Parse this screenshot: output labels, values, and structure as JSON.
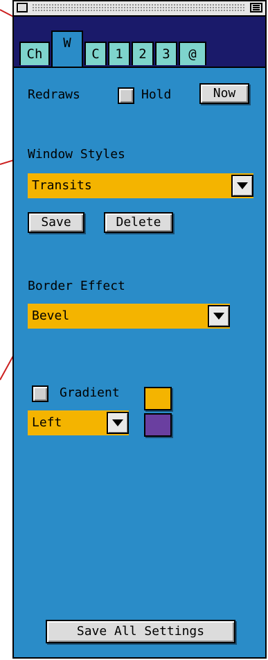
{
  "tabs": [
    {
      "label": "Ch",
      "active": false
    },
    {
      "label": "W",
      "active": true
    },
    {
      "label": "C",
      "active": false
    },
    {
      "label": "1",
      "active": false
    },
    {
      "label": "2",
      "active": false
    },
    {
      "label": "3",
      "active": false
    },
    {
      "label": "@",
      "active": false
    }
  ],
  "redraws": {
    "label": "Redraws",
    "hold_label": "Hold",
    "hold_checked": false,
    "now_button": "Now"
  },
  "window_styles": {
    "label": "Window Styles",
    "selected": "Transits",
    "save_button": "Save",
    "delete_button": "Delete"
  },
  "border_effect": {
    "label": "Border Effect",
    "selected": "Bevel"
  },
  "gradient": {
    "label": "Gradient",
    "checked": false,
    "direction": "Left"
  },
  "swatch_colors": {
    "top": "#f4b400",
    "bottom": "#6a3fa0"
  },
  "save_all_button": "Save All Settings",
  "theme_colors": {
    "panel_bg": "#2a8cc8",
    "tab_inactive_bg": "#7ed4cc",
    "tabstrip_bg": "#1a1a6a",
    "popup_bg": "#f4b400",
    "callout_line": "#cc2020"
  },
  "icons": {
    "close_box": "close-box-icon",
    "collapse_box": "collapse-icon",
    "popup_arrow": "chevron-down-icon"
  }
}
